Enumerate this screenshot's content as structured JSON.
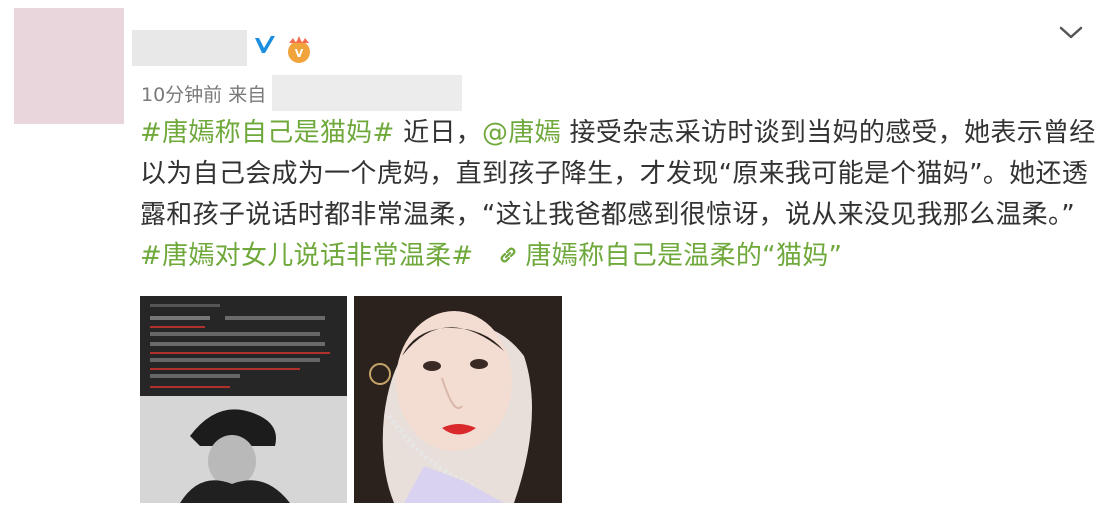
{
  "post": {
    "meta": {
      "time": "10分钟前",
      "from_label": "来自"
    },
    "content": {
      "line1": {
        "hashtag1": "#唐嫣称自己是猫妈#",
        "text1": " 近日，",
        "mention": "@唐嫣",
        "text2": " 接受杂志采访时谈到当妈的感受，她表示曾经"
      },
      "line2": "以为自己会成为一个虎妈，直到孩子降生，才发现“原来我可能是个猫妈”。她还透",
      "line3": "露和孩子说话时都非常温柔，“这让我爸都感到很惊讶，说从来没见我那么温柔。”",
      "line4": {
        "hashtag2": "#唐嫣对女儿说话非常温柔#",
        "link_text": "唐嫣称自己是温柔的“猫妈”"
      }
    },
    "icons": {
      "verified": "verified-v-icon",
      "vip": "vip-crown-icon",
      "more": "chevron-down-icon",
      "link": "link-chain-icon"
    },
    "colors": {
      "link": "#6fa83b",
      "verified": "#1a8fe0",
      "text": "#333333",
      "meta": "#7a7a7a"
    }
  }
}
